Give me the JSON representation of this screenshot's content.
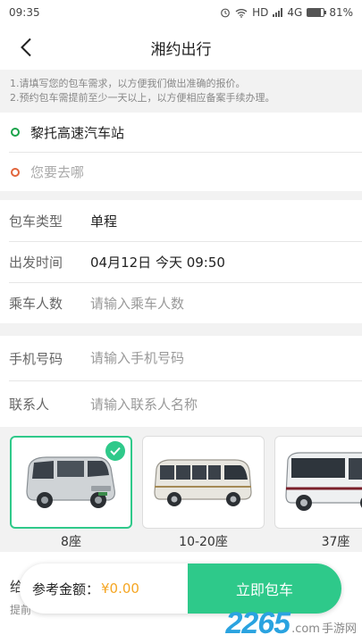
{
  "status_bar": {
    "time": "09:35",
    "network": "HD",
    "cellular": "4G",
    "battery": "81%",
    "battery_level": 0.81
  },
  "nav": {
    "title": "湘约出行"
  },
  "notice": {
    "line1": "1.请填写您的包车需求，以方便我们做出准确的报价。",
    "line2": "2.预约包车需提前至少一天以上，以方便相应备案手续办理。"
  },
  "locations": {
    "start": "黎托高速汽车站",
    "destination_placeholder": "您要去哪"
  },
  "trip": {
    "type_label": "包车类型",
    "type_value": "单程",
    "depart_label": "出发时间",
    "depart_value": "04月12日 今天 09:50",
    "passengers_label": "乘车人数",
    "passengers_placeholder": "请输入乘车人数"
  },
  "contact": {
    "phone_label": "手机号码",
    "phone_placeholder": "请输入手机号码",
    "name_label": "联系人",
    "name_placeholder": "请输入联系人名称"
  },
  "vehicles": [
    {
      "label": "8座",
      "selected": true
    },
    {
      "label": "10-20座",
      "selected": false
    },
    {
      "label": "37座",
      "selected": false
    }
  ],
  "bottom": {
    "peek_1": "给",
    "peek_2": "提前"
  },
  "price_bar": {
    "label": "参考金额：",
    "value": "¥0.00",
    "book_label": "立即包车"
  },
  "watermark": {
    "number": "2265",
    "suffix": ".com",
    "text": "手游网"
  },
  "colors": {
    "accent_green": "#2ec98a",
    "start_dot": "#1aa34a",
    "dest_dot": "#e1653c",
    "price": "#f5a623"
  }
}
